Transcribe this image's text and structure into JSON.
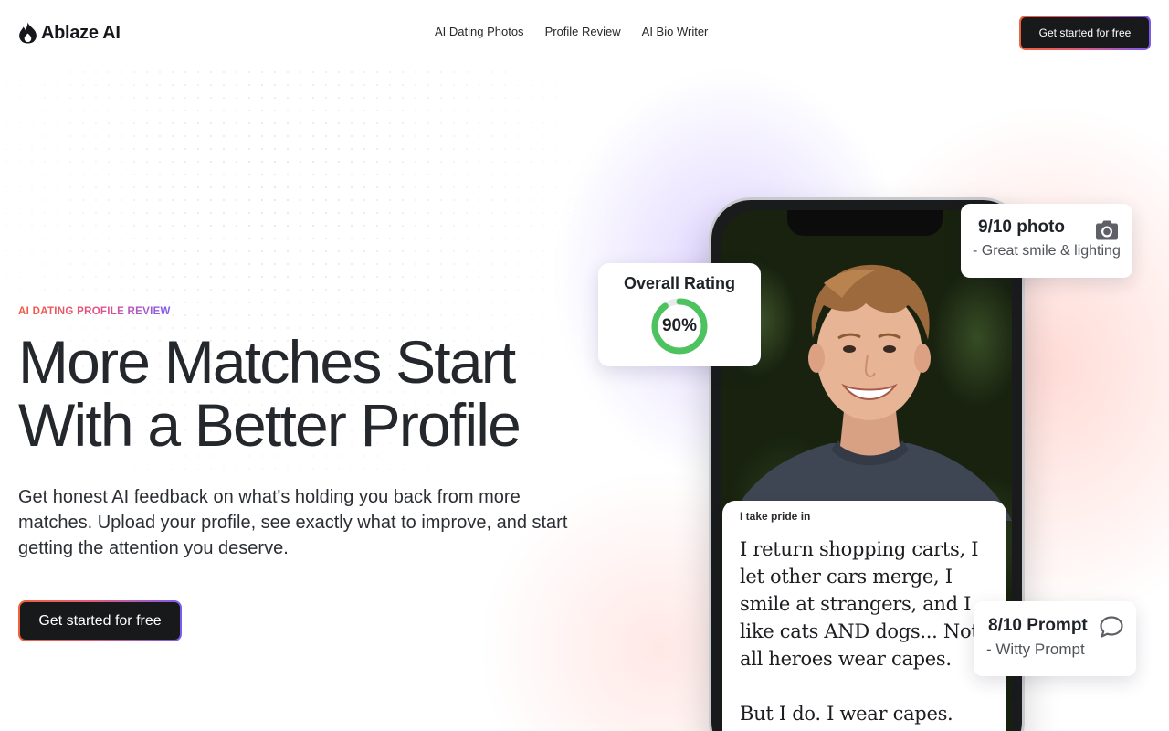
{
  "brand": {
    "name": "Ablaze AI"
  },
  "nav": {
    "items": [
      {
        "label": "AI Dating Photos"
      },
      {
        "label": "Profile Review"
      },
      {
        "label": "AI Bio Writer"
      }
    ],
    "cta_label": "Get started for free"
  },
  "hero": {
    "eyebrow": "AI DATING PROFILE REVIEW",
    "headline_line1": "More Matches Start",
    "headline_line2": "With a Better Profile",
    "subtext": "Get honest AI feedback on what's holding you back from more matches. Upload your profile, see exactly what to improve, and start getting the attention you deserve.",
    "cta_label": "Get started for free"
  },
  "rating_card": {
    "title": "Overall Rating",
    "value": "90%",
    "progress": 0.9
  },
  "photo_card": {
    "score": "9/10 photo",
    "note": "- Great smile & lighting",
    "icon": "camera-icon"
  },
  "prompt_card": {
    "label": "I take pride in",
    "body_p1": "I return shopping carts, I let other cars merge, I smile at strangers, and I like cats AND dogs... Not all heroes wear capes.",
    "body_p2": "But I do. I wear capes."
  },
  "prompt_score_card": {
    "score": "8/10 Prompt",
    "note": "- Witty Prompt",
    "icon": "chat-bubble-icon"
  },
  "colors": {
    "gradient_start": "#f0613d",
    "gradient_mid": "#e35a7a",
    "gradient_end": "#7b5cf0",
    "button_bg": "#18191b",
    "ring_green": "#4cc35e"
  }
}
